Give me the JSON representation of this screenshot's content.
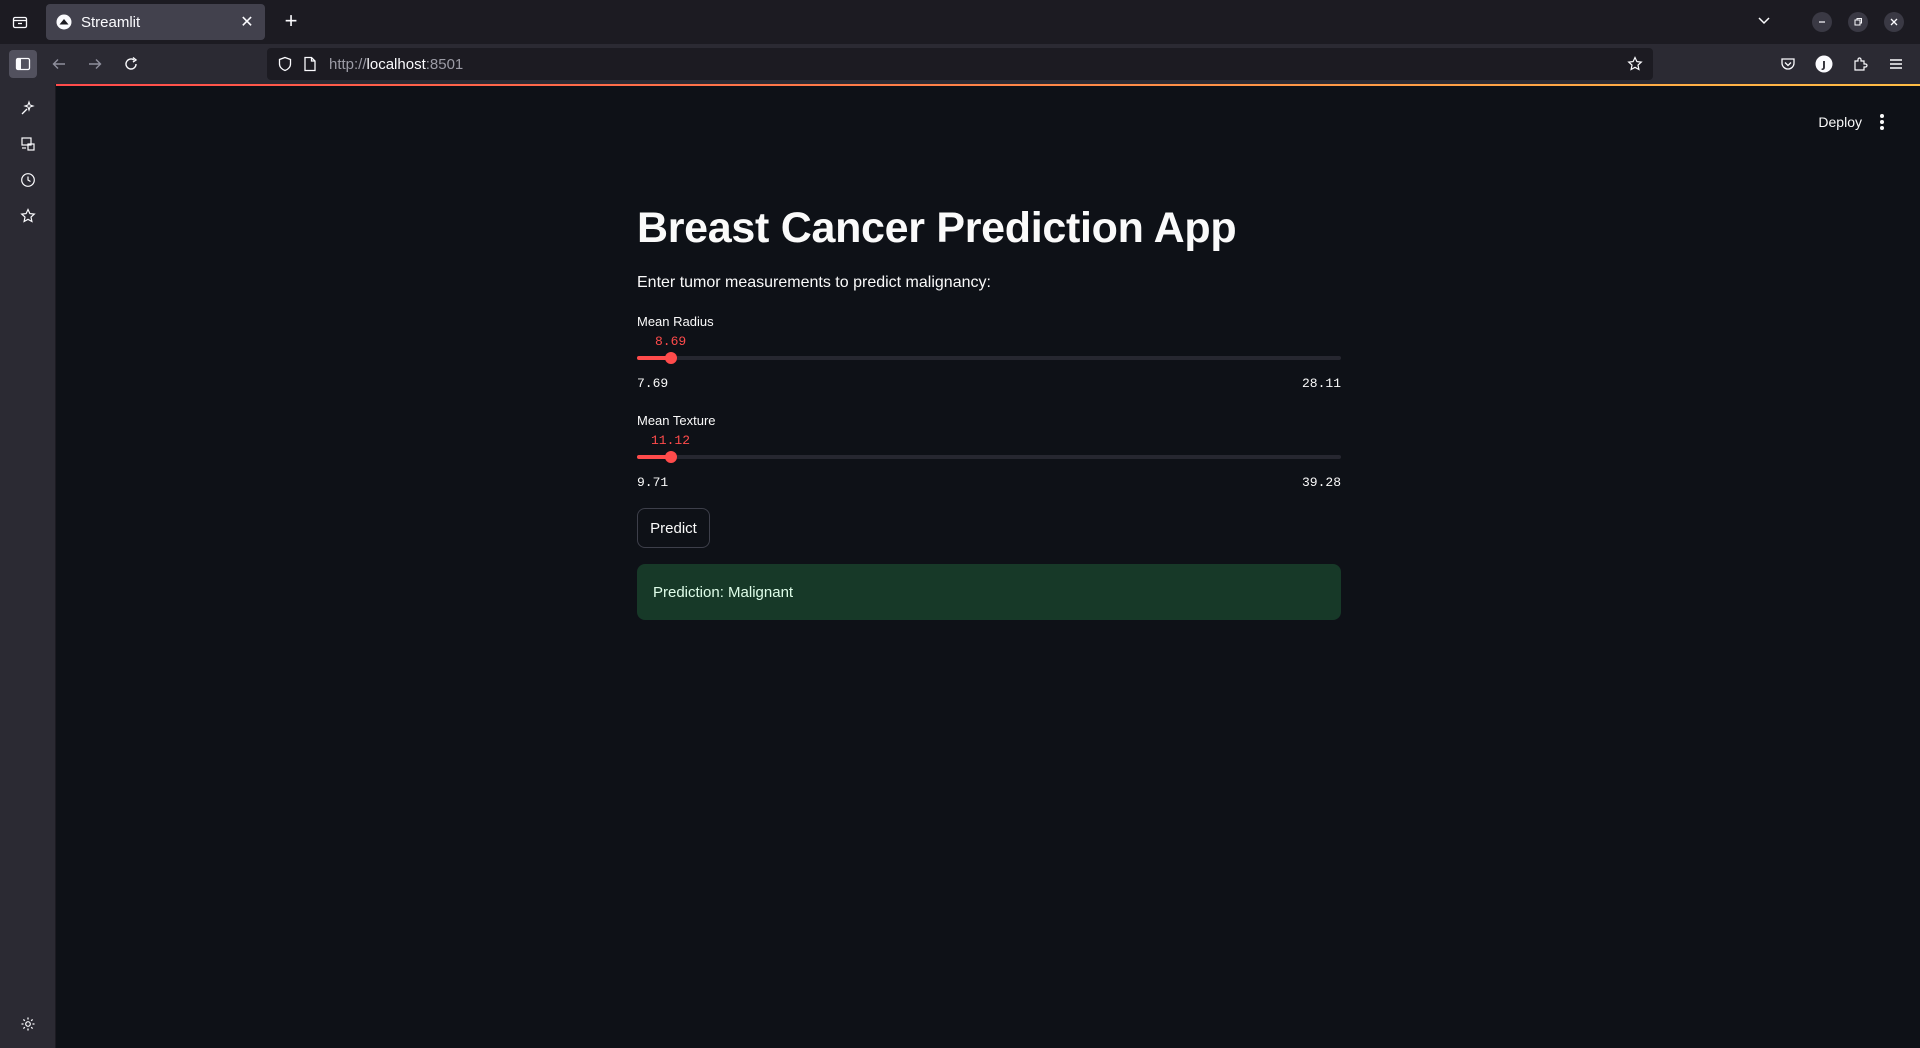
{
  "browser": {
    "tab_title": "Streamlit",
    "url_scheme": "http://",
    "url_host": "localhost",
    "url_port": ":8501"
  },
  "app": {
    "deploy_label": "Deploy",
    "title": "Breast Cancer Prediction App",
    "subtitle": "Enter tumor measurements to predict malignancy:",
    "sliders": [
      {
        "label": "Mean Radius",
        "value": "8.69",
        "min": "7.69",
        "max": "28.11",
        "fraction": 0.049
      },
      {
        "label": "Mean Texture",
        "value": "11.12",
        "min": "9.71",
        "max": "39.28",
        "fraction": 0.048
      }
    ],
    "predict_label": "Predict",
    "result_text": "Prediction: Malignant"
  },
  "colors": {
    "accent": "#ff4b4b",
    "background": "#0e1117",
    "success_bg": "#173928"
  }
}
